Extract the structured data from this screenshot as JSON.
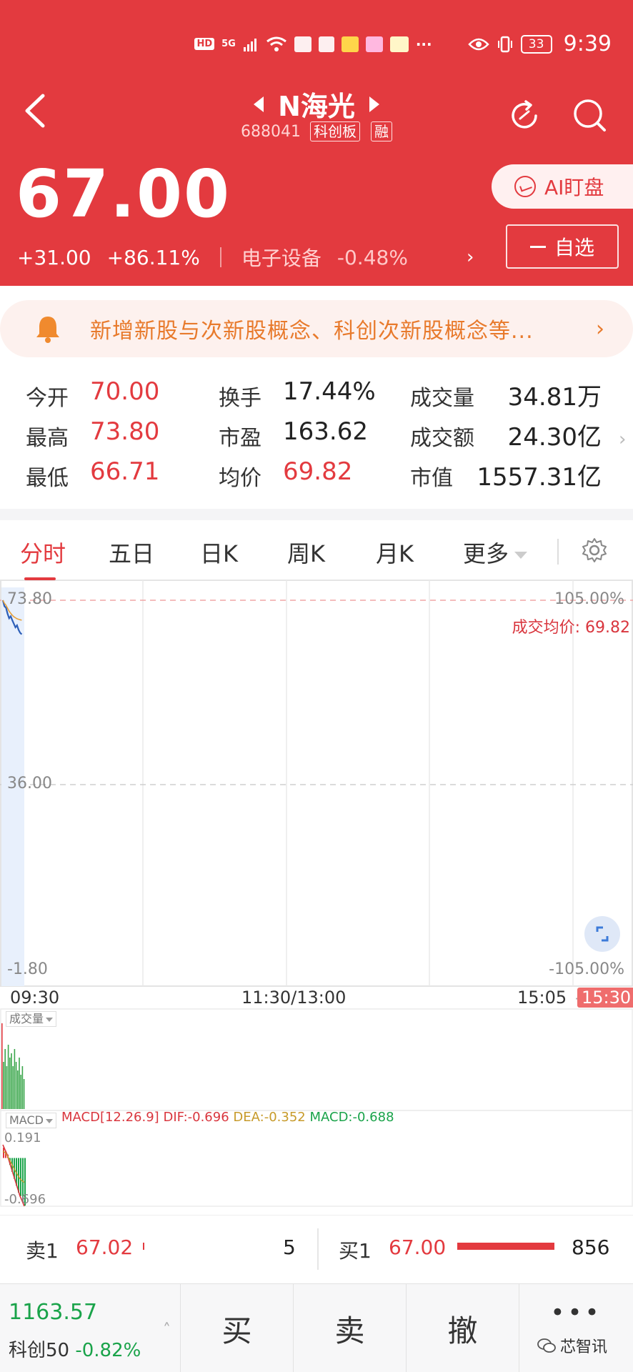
{
  "colors": {
    "header_red": "#e33a3f",
    "up_red": "#e33a3f",
    "down_green": "#1aa34a",
    "notice_orange": "#e87a2c"
  },
  "status_bar": {
    "hd": "HD",
    "signal": "5G",
    "battery": "33",
    "time": "9:39"
  },
  "header": {
    "title": "N海光",
    "code": "688041",
    "board_tag": "科创板",
    "margin_tag": "融",
    "price": "67.00",
    "change": "+31.00",
    "change_pct": "+86.11%",
    "industry": "电子设备",
    "industry_change": "-0.48%",
    "ai_button": "AI盯盘",
    "watchlist_button": "自选"
  },
  "notice": {
    "text": "新增新股与次新股概念、科创次新股概念等..."
  },
  "quote": {
    "rows": [
      [
        {
          "label": "今开",
          "value": "70.00"
        },
        {
          "label": "换手",
          "value": "17.44%"
        },
        {
          "label": "成交量",
          "value": "34.81万"
        }
      ],
      [
        {
          "label": "最高",
          "value": "73.80"
        },
        {
          "label": "市盈",
          "value": "163.62"
        },
        {
          "label": "成交额",
          "value": "24.30亿"
        }
      ],
      [
        {
          "label": "最低",
          "value": "66.71"
        },
        {
          "label": "均价",
          "value": "69.82"
        },
        {
          "label": "市值",
          "value": "1557.31亿"
        }
      ]
    ]
  },
  "tabs": [
    "分时",
    "五日",
    "日K",
    "周K",
    "月K",
    "更多"
  ],
  "chart_data": {
    "type": "line",
    "y_left_ticks": [
      "73.80",
      "36.00",
      "-1.80"
    ],
    "y_right_ticks": [
      "105.00%",
      "-105.00%"
    ],
    "avg_price_label": "成交均价: 69.82",
    "x_ticks": [
      "09:30",
      "11:30/13:00",
      "15:05",
      "15:30"
    ],
    "ylim": [
      -1.8,
      73.8
    ],
    "price_series": [
      73.8,
      72.6,
      72.3,
      71.1,
      70.2,
      70.6,
      69.8,
      69.1,
      68.4,
      68.8,
      67.9,
      67.3,
      67.0
    ],
    "avg_series": [
      73.8,
      73.2,
      72.8,
      72.2,
      71.6,
      71.2,
      70.8,
      70.5,
      70.3,
      70.1,
      70.0,
      69.9,
      69.82
    ],
    "volume_label": "成交量",
    "volume_bars": [
      1.0,
      0.55,
      0.7,
      0.5,
      0.75,
      0.6,
      0.65,
      0.5,
      0.7,
      0.55,
      0.45,
      0.6,
      0.4,
      0.5,
      0.35
    ],
    "macd": {
      "label": "MACD",
      "params": "MACD[12.26.9]",
      "dif": "DIF:-0.696",
      "dea": "DEA:-0.352",
      "macd": "MACD:-0.688",
      "top": "0.191",
      "bottom": "-0.696",
      "dif_series": [
        0.191,
        0.12,
        0.05,
        -0.05,
        -0.15,
        -0.25,
        -0.35,
        -0.45,
        -0.55,
        -0.62,
        -0.696
      ],
      "dea_series": [
        0.1,
        0.08,
        0.04,
        -0.02,
        -0.08,
        -0.14,
        -0.2,
        -0.25,
        -0.3,
        -0.33,
        -0.352
      ],
      "hist": [
        0.15,
        0.1,
        0.05,
        -0.1,
        -0.2,
        -0.3,
        -0.4,
        -0.5,
        -0.55,
        -0.62,
        -0.688
      ]
    }
  },
  "order_book": {
    "sell1_label": "卖1",
    "sell1_price": "67.02",
    "sell1_vol": "5",
    "buy1_label": "买1",
    "buy1_price": "67.00",
    "buy1_vol": "856"
  },
  "bottom_bar": {
    "index_value": "1163.57",
    "index_name": "科创50",
    "index_change": "-0.82%",
    "buy": "买",
    "sell": "卖",
    "cancel": "撤",
    "more": "•••",
    "watermark": "芯智讯"
  }
}
